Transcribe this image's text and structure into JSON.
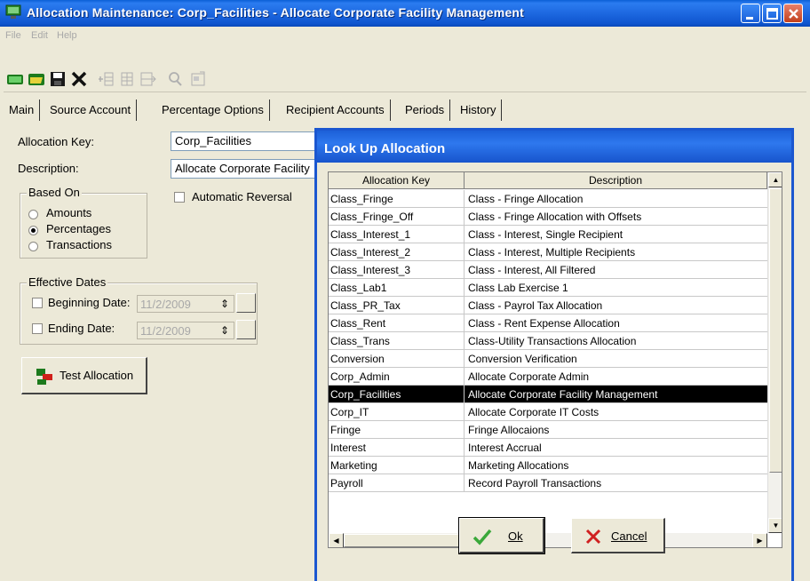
{
  "window": {
    "title": "Allocation Maintenance: Corp_Facilities - Allocate Corporate Facility Management"
  },
  "menu": {
    "items": [
      "File",
      "Edit",
      "Help"
    ]
  },
  "tabs": [
    "Main",
    "Source Account",
    "Percentage Options",
    "Recipient Accounts",
    "Periods",
    "History"
  ],
  "form": {
    "allocation_key_label": "Allocation Key:",
    "allocation_key_value": "Corp_Facilities",
    "description_label": "Description:",
    "description_value": "Allocate Corporate Facility",
    "based_on": {
      "title": "Based On",
      "options": [
        "Amounts",
        "Percentages",
        "Transactions"
      ],
      "selected": "Percentages"
    },
    "automatic_reversal_label": "Automatic Reversal",
    "effective_dates": {
      "title": "Effective Dates",
      "beginning_label": "Beginning Date:",
      "beginning_value": "11/2/2009",
      "ending_label": "Ending Date:",
      "ending_value": "11/2/2009"
    },
    "test_allocation_label": "Test Allocation"
  },
  "lookup": {
    "title": "Look Up Allocation",
    "columns": [
      "Allocation Key",
      "Description"
    ],
    "rows": [
      {
        "key": "Class_Fringe",
        "desc": "Class - Fringe Allocation"
      },
      {
        "key": "Class_Fringe_Off",
        "desc": "Class - Fringe Allocation with Offsets"
      },
      {
        "key": "Class_Interest_1",
        "desc": "Class - Interest, Single Recipient"
      },
      {
        "key": "Class_Interest_2",
        "desc": "Class - Interest, Multiple Recipients"
      },
      {
        "key": "Class_Interest_3",
        "desc": "Class - Interest, All Filtered"
      },
      {
        "key": "Class_Lab1",
        "desc": "Class Lab Exercise 1"
      },
      {
        "key": "Class_PR_Tax",
        "desc": "Class - Payrol Tax Allocation"
      },
      {
        "key": "Class_Rent",
        "desc": "Class - Rent Expense Allocation"
      },
      {
        "key": "Class_Trans",
        "desc": "Class-Utility Transactions Allocation"
      },
      {
        "key": "Conversion",
        "desc": "Conversion Verification"
      },
      {
        "key": "Corp_Admin",
        "desc": "Allocate Corporate Admin"
      },
      {
        "key": "Corp_Facilities",
        "desc": "Allocate Corporate Facility Management",
        "selected": true
      },
      {
        "key": "Corp_IT",
        "desc": "Allocate Corporate IT Costs"
      },
      {
        "key": "Fringe",
        "desc": "Fringe Allocaions"
      },
      {
        "key": "Interest",
        "desc": "Interest Accrual"
      },
      {
        "key": "Marketing",
        "desc": "Marketing Allocations"
      },
      {
        "key": "Payroll",
        "desc": "Record Payroll Transactions"
      }
    ],
    "ok_label": "Ok",
    "cancel_label": "Cancel"
  }
}
